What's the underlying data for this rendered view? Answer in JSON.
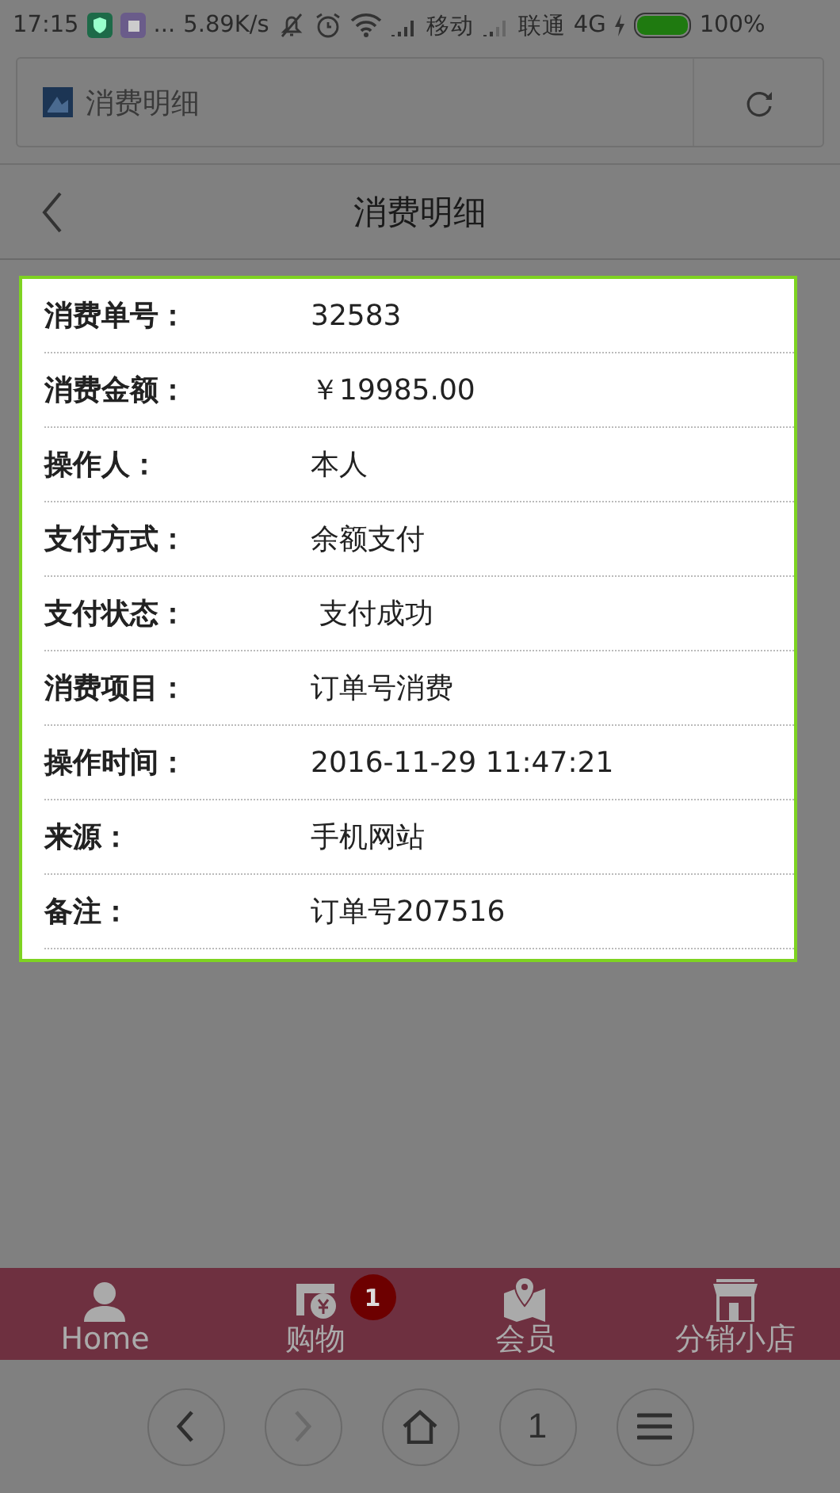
{
  "status_bar": {
    "time": "17:15",
    "dots": "...",
    "speed": "5.89K/s",
    "carrier_1": "移动",
    "carrier_2": "联通",
    "network": "4G",
    "battery": "100%"
  },
  "address_bar": {
    "title": "消费明细"
  },
  "header": {
    "title": "消费明细"
  },
  "details": [
    {
      "label": "消费单号：",
      "value": "32583"
    },
    {
      "label": "消费金额：",
      "value": "￥19985.00"
    },
    {
      "label": "操作人：",
      "value": "本人"
    },
    {
      "label": "支付方式：",
      "value": "余额支付"
    },
    {
      "label": "支付状态：",
      "value": " 支付成功"
    },
    {
      "label": "消费项目：",
      "value": "订单号消费"
    },
    {
      "label": "操作时间：",
      "value": "2016-11-29 11:47:21"
    },
    {
      "label": "来源：",
      "value": "手机网站"
    },
    {
      "label": "备注：",
      "value": "订单号207516"
    }
  ],
  "tab_bar": [
    {
      "kind": "person",
      "label": "Home"
    },
    {
      "kind": "wallet",
      "label": "购物",
      "badge": "1"
    },
    {
      "kind": "map",
      "label": "会员"
    },
    {
      "kind": "shop",
      "label": "分销小店"
    }
  ],
  "browser_controls": [
    {
      "kind": "back",
      "disabled": false
    },
    {
      "kind": "forward",
      "disabled": true
    },
    {
      "kind": "home",
      "disabled": false
    },
    {
      "kind": "tabs",
      "label": "1",
      "disabled": false
    },
    {
      "kind": "menu",
      "disabled": false
    }
  ]
}
